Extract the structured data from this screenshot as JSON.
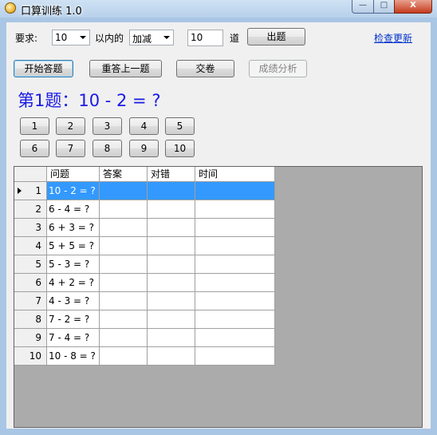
{
  "window": {
    "title": "口算训练 1.0",
    "controls": {
      "min": "—",
      "max": "□",
      "close": "X"
    }
  },
  "toolbar": {
    "req_label": "要求:",
    "range_value": "10",
    "within_label": "以内的",
    "op_value": "加减",
    "count_value": "10",
    "count_unit": "道",
    "generate_label": "出题",
    "update_link": "检查更新"
  },
  "actions": {
    "start": "开始答题",
    "redo": "重答上一题",
    "submit": "交卷",
    "analysis": "成绩分析"
  },
  "question": "第1题：10 - 2 = ?",
  "keypad": [
    "1",
    "2",
    "3",
    "4",
    "5",
    "6",
    "7",
    "8",
    "9",
    "10"
  ],
  "table": {
    "columns": [
      "问题",
      "答案",
      "对错",
      "时间"
    ],
    "rows": [
      {
        "n": "1",
        "q": "10 - 2 = ?",
        "a": "",
        "r": "",
        "t": ""
      },
      {
        "n": "2",
        "q": "6 - 4 = ?",
        "a": "",
        "r": "",
        "t": ""
      },
      {
        "n": "3",
        "q": "6 + 3 = ?",
        "a": "",
        "r": "",
        "t": ""
      },
      {
        "n": "4",
        "q": "5 + 5 = ?",
        "a": "",
        "r": "",
        "t": ""
      },
      {
        "n": "5",
        "q": "5 - 3 = ?",
        "a": "",
        "r": "",
        "t": ""
      },
      {
        "n": "6",
        "q": "4 + 2 = ?",
        "a": "",
        "r": "",
        "t": ""
      },
      {
        "n": "7",
        "q": "4 - 3 = ?",
        "a": "",
        "r": "",
        "t": ""
      },
      {
        "n": "8",
        "q": "7 - 2 = ?",
        "a": "",
        "r": "",
        "t": ""
      },
      {
        "n": "9",
        "q": "7 - 4 = ?",
        "a": "",
        "r": "",
        "t": ""
      },
      {
        "n": "10",
        "q": "10 - 8 = ?",
        "a": "",
        "r": "",
        "t": ""
      }
    ]
  },
  "colors": {
    "accent": "#1a1ae6",
    "selection": "#3399ff",
    "link": "#0033cc"
  }
}
